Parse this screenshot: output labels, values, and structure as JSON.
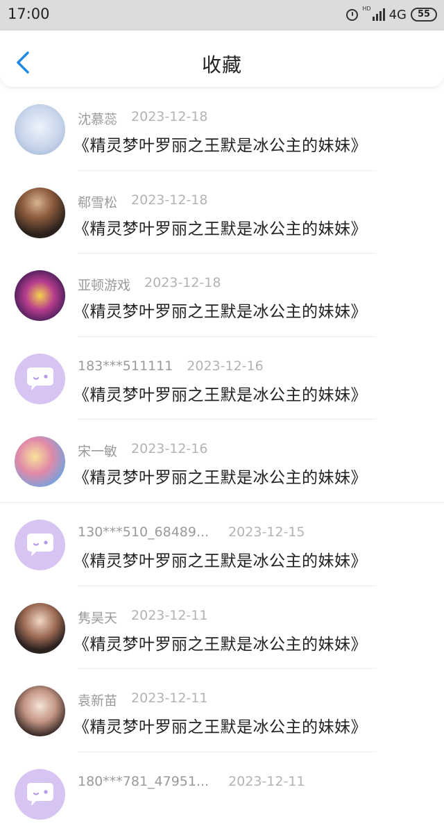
{
  "status_bar": {
    "time": "17:00",
    "hd": "HD",
    "network": "4G",
    "battery": "55"
  },
  "header": {
    "title": "收藏",
    "back_icon": "chevron-left-icon"
  },
  "favorites": [
    {
      "user": "沈慕蕊",
      "date": "2023-12-18",
      "title": "《精灵梦叶罗丽之王默是冰公主的妹妹》"
    },
    {
      "user": "郗雪松",
      "date": "2023-12-18",
      "title": "《精灵梦叶罗丽之王默是冰公主的妹妹》"
    },
    {
      "user": "亚顿游戏",
      "date": "2023-12-18",
      "title": "《精灵梦叶罗丽之王默是冰公主的妹妹》"
    },
    {
      "user": "183***511111",
      "date": "2023-12-16",
      "title": "《精灵梦叶罗丽之王默是冰公主的妹妹》"
    },
    {
      "user": "宋一敏",
      "date": "2023-12-16",
      "title": "《精灵梦叶罗丽之王默是冰公主的妹妹》"
    },
    {
      "user": "130***510_68489...",
      "date": "2023-12-15",
      "title": "《精灵梦叶罗丽之王默是冰公主的妹妹》"
    },
    {
      "user": "隽昊天",
      "date": "2023-12-11",
      "title": "《精灵梦叶罗丽之王默是冰公主的妹妹》"
    },
    {
      "user": "袁新苗",
      "date": "2023-12-11",
      "title": "《精灵梦叶罗丽之王默是冰公主的妹妹》"
    },
    {
      "user": "180***781_47951...",
      "date": "2023-12-11",
      "title": ""
    }
  ],
  "colors": {
    "accent": "#1e88e5",
    "default_avatar_bg": "#d7c4f3"
  }
}
